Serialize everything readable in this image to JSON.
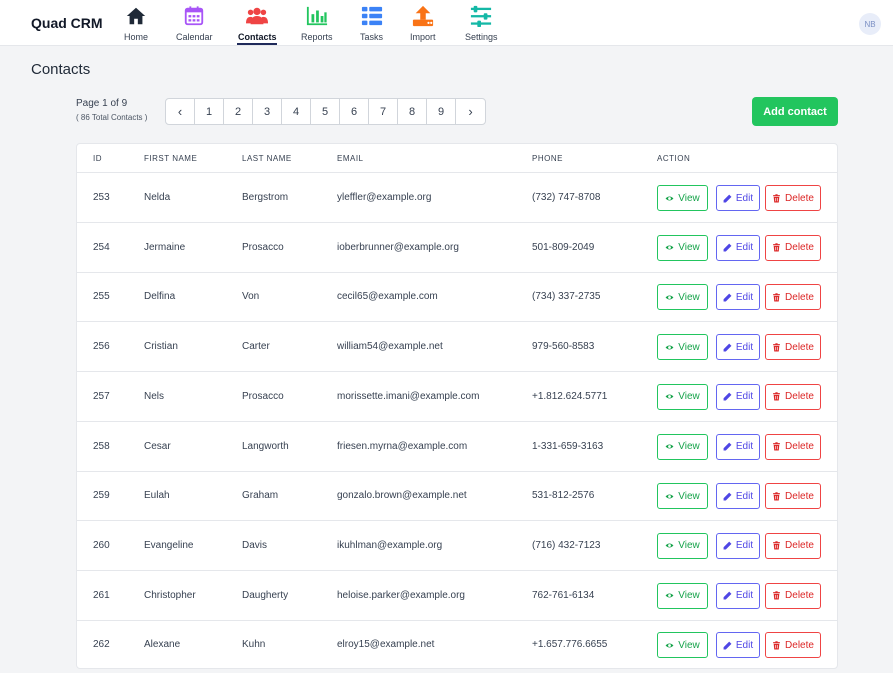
{
  "app": {
    "brand": "Quad CRM",
    "avatar_initials": "NB"
  },
  "nav": [
    {
      "label": "Home",
      "icon": "home-icon",
      "color": "#1f2937"
    },
    {
      "label": "Calendar",
      "icon": "calendar-icon",
      "color": "#a855f7"
    },
    {
      "label": "Contacts",
      "icon": "contacts-icon",
      "color": "#ef4444",
      "active": true
    },
    {
      "label": "Reports",
      "icon": "bar-chart-icon",
      "color": "#22c55e"
    },
    {
      "label": "Tasks",
      "icon": "list-icon",
      "color": "#3b82f6"
    },
    {
      "label": "Import",
      "icon": "upload-icon",
      "color": "#f97316"
    },
    {
      "label": "Settings",
      "icon": "sliders-icon",
      "color": "#14b8a6"
    }
  ],
  "page": {
    "title": "Contacts"
  },
  "pagination": {
    "page_label": "Page 1 of 9",
    "total_label": "( 86 Total Contacts )",
    "prev": "‹",
    "next": "›",
    "pages": [
      "1",
      "2",
      "3",
      "4",
      "5",
      "6",
      "7",
      "8",
      "9"
    ]
  },
  "add_button": "Add contact",
  "table": {
    "columns": [
      "ID",
      "FIRST NAME",
      "LAST NAME",
      "EMAIL",
      "PHONE",
      "ACTION"
    ],
    "actions": {
      "view": "View",
      "edit": "Edit",
      "delete": "Delete"
    },
    "rows": [
      {
        "id": "253",
        "first": "Nelda",
        "last": "Bergstrom",
        "email": "yleffler@example.org",
        "phone": "(732) 747-8708"
      },
      {
        "id": "254",
        "first": "Jermaine",
        "last": "Prosacco",
        "email": "ioberbrunner@example.org",
        "phone": "501-809-2049"
      },
      {
        "id": "255",
        "first": "Delfina",
        "last": "Von",
        "email": "cecil65@example.com",
        "phone": "(734) 337-2735"
      },
      {
        "id": "256",
        "first": "Cristian",
        "last": "Carter",
        "email": "william54@example.net",
        "phone": "979-560-8583"
      },
      {
        "id": "257",
        "first": "Nels",
        "last": "Prosacco",
        "email": "morissette.imani@example.com",
        "phone": "+1.812.624.5771"
      },
      {
        "id": "258",
        "first": "Cesar",
        "last": "Langworth",
        "email": "friesen.myrna@example.com",
        "phone": "1-331-659-3163"
      },
      {
        "id": "259",
        "first": "Eulah",
        "last": "Graham",
        "email": "gonzalo.brown@example.net",
        "phone": "531-812-2576"
      },
      {
        "id": "260",
        "first": "Evangeline",
        "last": "Davis",
        "email": "ikuhlman@example.org",
        "phone": "(716) 432-7123"
      },
      {
        "id": "261",
        "first": "Christopher",
        "last": "Daugherty",
        "email": "heloise.parker@example.org",
        "phone": "762-761-6134"
      },
      {
        "id": "262",
        "first": "Alexane",
        "last": "Kuhn",
        "email": "elroy15@example.net",
        "phone": "+1.657.776.6655"
      }
    ]
  }
}
